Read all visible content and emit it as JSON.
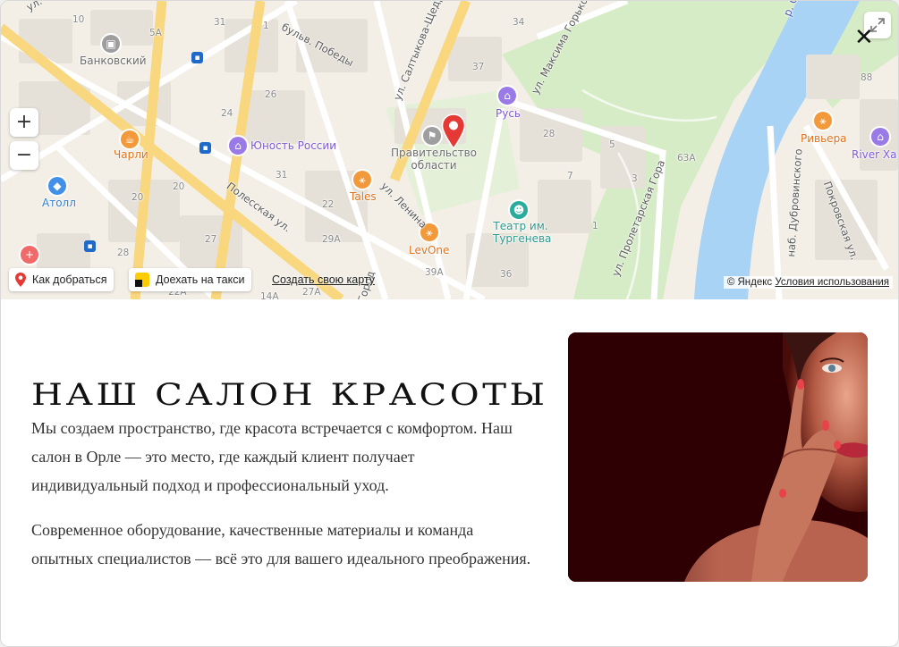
{
  "map": {
    "zoom_in": "+",
    "zoom_out": "−",
    "route_button": "Как добраться",
    "taxi_button": "Доехать на такси",
    "create_map_link": "Создать свою карту",
    "copyright": "© Яндекс",
    "terms": "Условия использования",
    "close": "✕",
    "labels": {
      "bankovskiy": "Банковский",
      "charli": "Чарли",
      "atoll": "Атолл",
      "yunost": "Юность России",
      "pravitelstvo": "Правительство области",
      "tales": "Tales",
      "levone": "LevOne",
      "rus": "Русь",
      "teatr": "Театр им. Тургенева",
      "riviera": "Ривьера",
      "river_ha": "River Ха",
      "bulv_pobedy": "бульв. Победы",
      "saltykova": "ул. Салтыкова-Щедрина",
      "gorkogo": "ул. Максима Горького",
      "polesskaya": "Полесская ул.",
      "lenina": "ул. Ленина",
      "proletarskaya": "ул. Пролетарская Гора",
      "dubrovinskogo": "наб. Дубровинского",
      "pokrovskaya": "Покровская ул.",
      "oka": "р. Ока",
      "ul_top": "ул.",
      "gorod": "Город"
    },
    "house_numbers": [
      "10",
      "5А",
      "31",
      "1",
      "34",
      "26",
      "24",
      "37",
      "28",
      "5",
      "31",
      "63А",
      "88",
      "20",
      "20",
      "22",
      "3",
      "29А",
      "1",
      "27",
      "28",
      "39А",
      "36",
      "22А",
      "27А",
      "14А",
      "7"
    ]
  },
  "content": {
    "title": "Наш салон красоты",
    "paragraph1": "Мы создаем пространство, где красота встречается с комфортом. Наш салон в Орле — это место, где каждый клиент получает индивидуальный подход и профессиональный уход.",
    "paragraph2": "Современное оборудование, качественные материалы и команда опытных специалистов — всё это для вашего идеального преображения."
  },
  "colors": {
    "accent_pin": "#e53935",
    "river": "#a9d3f5",
    "park": "#d6ecc6",
    "road_major": "#f9d77e",
    "photo_bg": "#2e0003"
  }
}
